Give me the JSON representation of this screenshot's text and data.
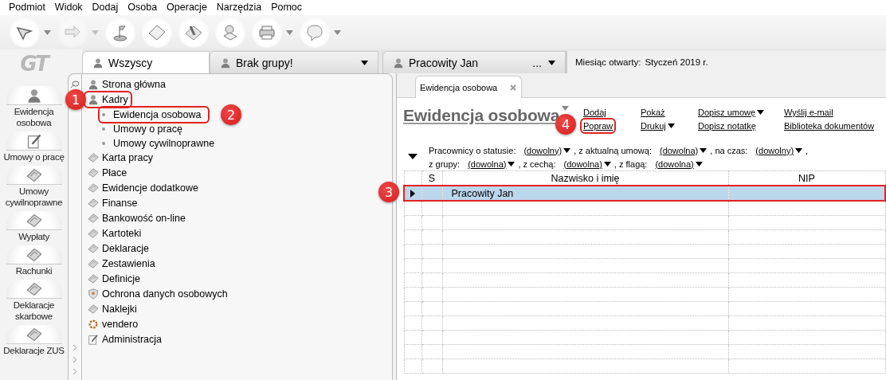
{
  "menu": [
    "Podmiot",
    "Widok",
    "Dodaj",
    "Osoba",
    "Operacje",
    "Narzędzia",
    "Pomoc"
  ],
  "toolbar": [
    {
      "dropdown": true,
      "disabled": false
    },
    {
      "dropdown": true,
      "disabled": true
    },
    {
      "dropdown": false,
      "disabled": false
    },
    {
      "dropdown": false,
      "disabled": false
    },
    {
      "dropdown": false,
      "disabled": false
    },
    {
      "dropdown": false,
      "disabled": false
    },
    {
      "dropdown": true,
      "disabled": false
    },
    {
      "dropdown": true,
      "disabled": false
    }
  ],
  "logo": "GT",
  "modules": [
    {
      "label": "Ewidencja osobowa"
    },
    {
      "label": "Umowy o pracę"
    },
    {
      "label": "Umowy cywilnoprawne"
    },
    {
      "label": "Wypłaty"
    },
    {
      "label": "Rachunki"
    },
    {
      "label": "Deklaracje skarbowe"
    },
    {
      "label": "Deklaracje ZUS"
    }
  ],
  "group_tabs": [
    {
      "label": "Wszyscy",
      "selected": true,
      "dropdown": false
    },
    {
      "label": "Brak grupy!",
      "selected": false,
      "dropdown": true
    },
    {
      "label": "Pracowity Jan",
      "selected": false,
      "dropdown": true,
      "more": "..."
    }
  ],
  "month": {
    "label": "Miesiąc otwarty:",
    "value": "Styczeń 2019 r."
  },
  "tree": [
    {
      "label": "Strona główna",
      "highlighted": false
    },
    {
      "label": "Kadry",
      "highlighted": true,
      "callout": "1",
      "expanded": true,
      "children": [
        {
          "label": "Ewidencja osobowa",
          "highlighted": true,
          "callout": "2"
        },
        {
          "label": "Umowy o pracę",
          "highlighted": false
        },
        {
          "label": "Umowy cywilnoprawne",
          "highlighted": false
        }
      ]
    },
    {
      "label": "Karta pracy",
      "highlighted": false
    },
    {
      "label": "Płace",
      "highlighted": false
    },
    {
      "label": "Ewidencje dodatkowe",
      "highlighted": false
    },
    {
      "label": "Finanse",
      "highlighted": false
    },
    {
      "label": "Bankowość on-line",
      "highlighted": false
    },
    {
      "label": "Kartoteki",
      "highlighted": false
    },
    {
      "label": "Deklaracje",
      "highlighted": false
    },
    {
      "label": "Zestawienia",
      "highlighted": false
    },
    {
      "label": "Definicje",
      "highlighted": false
    },
    {
      "label": "Ochrona danych osobowych",
      "highlighted": false
    },
    {
      "label": "Naklejki",
      "highlighted": false
    },
    {
      "label": "vendero",
      "highlighted": false
    },
    {
      "label": "Administracja",
      "highlighted": false
    }
  ],
  "doc_tab": {
    "label": "Ewidencja osobowa",
    "selected": true
  },
  "page_title": "Ewidencja osobowa",
  "actions": [
    [
      {
        "label": "Dodaj",
        "dropdown": false,
        "highlighted": false
      },
      {
        "label": "Popraw",
        "dropdown": false,
        "highlighted": true,
        "callout": "4"
      }
    ],
    [
      {
        "label": "Pokaż",
        "dropdown": false,
        "highlighted": false
      },
      {
        "label": "Drukuj",
        "dropdown": true,
        "highlighted": false
      }
    ],
    [
      {
        "label": "Dopisz umowę",
        "dropdown": true,
        "highlighted": false
      },
      {
        "label": "Dopisz notatkę",
        "dropdown": false,
        "highlighted": false
      }
    ],
    [
      {
        "label": "Wyślij e-mail",
        "dropdown": false,
        "highlighted": false
      },
      {
        "label": "Biblioteka dokumentów",
        "dropdown": false,
        "highlighted": false
      }
    ]
  ],
  "filters": [
    [
      {
        "label": "Pracownicy o statusie:",
        "value": "(dowolny)"
      },
      {
        "label": ", z aktualną umową:",
        "value": "(dowolna)"
      },
      {
        "label": ", na czas:",
        "value": "(dowolny)"
      },
      {
        "label": ","
      }
    ],
    [
      {
        "label": "z grupy:",
        "value": "(dowolna)"
      },
      {
        "label": ", z cechą:",
        "value": "(dowolna)"
      },
      {
        "label": ", z flagą:",
        "value": "(dowolna)"
      }
    ]
  ],
  "table": {
    "columns": [
      {
        "label": "S"
      },
      {
        "label": "Nazwisko i imię"
      },
      {
        "label": "NIP"
      }
    ],
    "rows": [
      {
        "name": "Pracowity Jan",
        "selected": true,
        "highlighted": true,
        "callout": "3"
      }
    ]
  }
}
